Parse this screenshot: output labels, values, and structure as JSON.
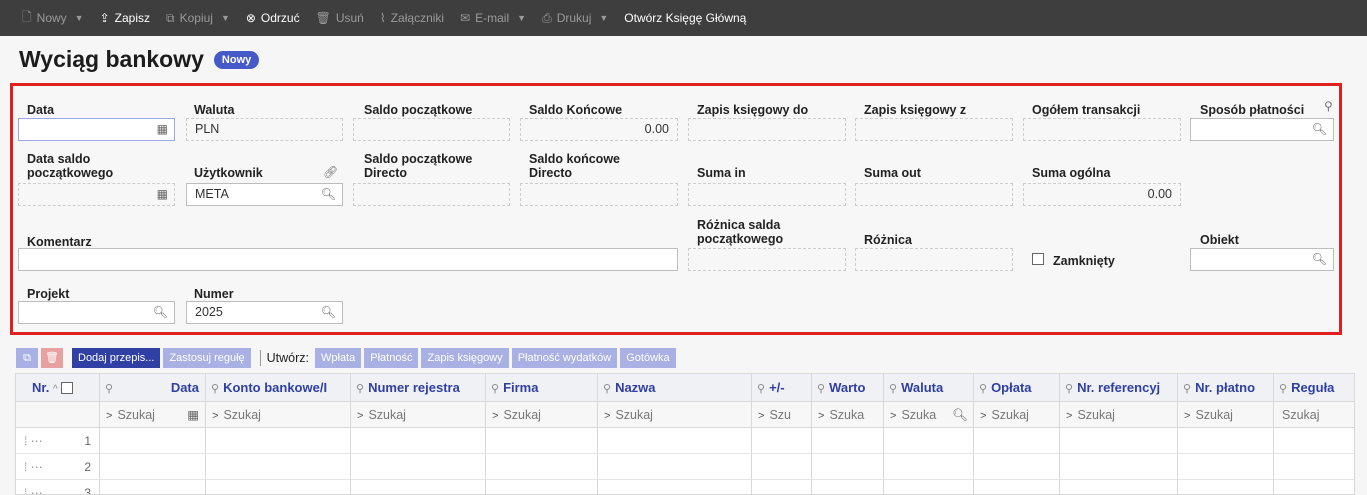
{
  "toolbar": {
    "items": [
      {
        "icon": "new-doc-icon",
        "label": "Nowy",
        "caret": true,
        "active": false
      },
      {
        "icon": "save-icon",
        "label": "Zapisz",
        "caret": false,
        "active": true
      },
      {
        "icon": "copy-icon",
        "label": "Kopiuj",
        "caret": true,
        "active": false
      },
      {
        "icon": "discard-icon",
        "label": "Odrzuć",
        "caret": false,
        "active": true
      },
      {
        "icon": "trash-icon",
        "label": "Usuń",
        "caret": false,
        "active": false
      },
      {
        "icon": "paperclip-icon",
        "label": "Załączniki",
        "caret": false,
        "active": false
      },
      {
        "icon": "mail-icon",
        "label": "E-mail",
        "caret": true,
        "active": false
      },
      {
        "icon": "printer-icon",
        "label": "Drukuj",
        "caret": true,
        "active": false
      },
      {
        "icon": "",
        "label": "Otwórz Księgę Główną",
        "caret": false,
        "active": true
      }
    ]
  },
  "page": {
    "title": "Wyciąg bankowy",
    "badge": "Nowy"
  },
  "form": {
    "data_label": "Data",
    "waluta_label": "Waluta",
    "waluta_value": "PLN",
    "saldo_pocz_label": "Saldo początkowe",
    "saldo_konc_label": "Saldo Końcowe",
    "saldo_konc_value": "0.00",
    "zapis_do_label": "Zapis księgowy do",
    "zapis_z_label": "Zapis księgowy z",
    "ogolem_label": "Ogółem transakcji",
    "sposob_label": "Sposób płatności",
    "data_saldo_label_1": "Data saldo",
    "data_saldo_label_2": "początkowego",
    "uzytkownik_label": "Użytkownik",
    "uzytkownik_value": "META",
    "saldo_pocz_dir_label_1": "Saldo początkowe",
    "saldo_pocz_dir_label_2": "Directo",
    "saldo_konc_dir_label_1": "Saldo końcowe",
    "saldo_konc_dir_label_2": "Directo",
    "suma_in_label": "Suma in",
    "suma_out_label": "Suma out",
    "suma_ogolna_label": "Suma ogólna",
    "suma_ogolna_value": "0.00",
    "komentarz_label": "Komentarz",
    "roznica_salda_label_1": "Różnica salda",
    "roznica_salda_label_2": "początkowego",
    "roznica_label": "Różnica",
    "zamkniety_label": "Zamknięty",
    "obiekt_label": "Obiekt",
    "projekt_label": "Projekt",
    "numer_label": "Numer",
    "numer_value": "2025"
  },
  "grid_toolbar": {
    "add_label": "Dodaj przepis...",
    "apply_label": "Zastosuj regułę",
    "create_label": "Utwórz:",
    "create_buttons": [
      "Wpłata",
      "Płatność",
      "Zapis księgowy",
      "Płatność wydatków",
      "Gotówka"
    ]
  },
  "grid": {
    "headers": [
      "Nr.",
      "Data",
      "Konto bankowe/I",
      "Numer rejestra",
      "Firma",
      "Nazwa",
      "+/-",
      "Warto",
      "Waluta",
      "Opłata",
      "Nr. referencyj",
      "Nr. płatno",
      "Reguła"
    ],
    "search_placeholder": "Szukaj",
    "search_short": [
      "Szukaj",
      "Szukaj",
      "Szukaj",
      "Szukaj",
      "Szukaj",
      "Szu",
      "Szuka",
      "Szuka",
      "Szukaj",
      "Szukaj",
      "Szukaj",
      "Szukaj"
    ],
    "rows": [
      "1",
      "2",
      "3"
    ]
  }
}
